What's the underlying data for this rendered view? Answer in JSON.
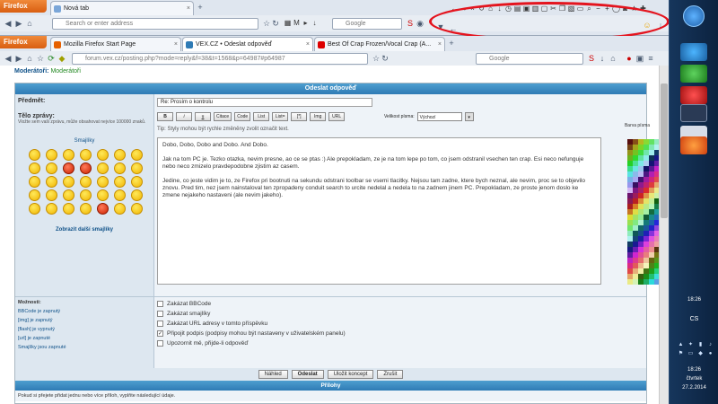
{
  "browser1": {
    "firefox_label": "Firefox",
    "tab_label": "Nová tab",
    "url_placeholder": "Search or enter address",
    "search_placeholder": "Google"
  },
  "browser2": {
    "firefox_label": "Firefox",
    "tabs": [
      {
        "label": "Mozilla Firefox Start Page"
      },
      {
        "label": "VEX.CZ • Odeslat odpověď"
      },
      {
        "label": "Best Of Crap Frozen/Vocal Crap (A..."
      }
    ],
    "url": "forum.vex.cz/posting.php?mode=reply&f=38&t=1568&p=64987#p64987",
    "search_placeholder": "Google"
  },
  "page": {
    "moderator_label": "Moderátoři:",
    "moderator_value": "Moderátoři",
    "panel_title": "Odeslat odpověď",
    "subject_label": "Předmět:",
    "subject_value": "Re: Prosím o kontrolu",
    "body_label": "Tělo zprávy:",
    "body_hint": "Vložte sem vaši zprávu, může obsahovat nejvíce 100000 znaků.",
    "smileys_title": "Smajlíky",
    "more_smileys": "Zobrazit další smajlíky",
    "bbcode_buttons": [
      "B",
      "i",
      "u",
      "Citace",
      "Code",
      "List",
      "List=",
      "[*]",
      "Img",
      "URL"
    ],
    "font_size_label": "Velikost písma:",
    "font_size_value": "Výchozí",
    "tip": "Tip: Styly mohou být rychle změněny zvolit označit text.",
    "message_lines": [
      "Dobo, Dobo, Dobo and Dobo. And Dobo.",
      "Jak na tom PC je. Tezko otazka, nevim presne, ao ce se ptas :) Ale prepokladam, ze je na tom lepe po tom, co jsem odstranil vsechen ten crap. Esi neco nefunguje nebo neco zmizelo pravdepodobne zjistim az casem.",
      "Jedine, co jeste vidim je to, ze Firefox pri bootnuti na sekundu odstrani toolbar se vsemi tlacitky. Nejsou tam zadne, ktere bych neznal, ale nevim, proc se to objevilo znovu. Pred tim, nez jsem nainstaloval ten zpropadeny conduit search to urcite nedelal a nedela to na zadnem jinem PC. Prepokladam, ze proste jenom doslo ke zmene nejakeho nastaveni (ale nevim jakeho)."
    ],
    "palette_label": "Barva písma",
    "options_label": "Možnosti:",
    "option_status": [
      "BBCode je zapnutý",
      "[img] je zapnutý",
      "[flash] je vypnutý",
      "[url] je zapnuté",
      "Smajlíky jsou zapnuté"
    ],
    "checkboxes": [
      {
        "label": "Zakázat BBCode",
        "checked": false
      },
      {
        "label": "Zakázat smajlíky",
        "checked": false
      },
      {
        "label": "Zakázat URL adresy v tomto příspěvku",
        "checked": false
      },
      {
        "label": "Připojit podpis (podpisy mohou být nastaveny v uživatelském panelu)",
        "checked": true
      },
      {
        "label": "Upozornit mě, přijde-li odpověď",
        "checked": false
      }
    ],
    "buttons": {
      "preview": "Náhled",
      "submit": "Odeslat",
      "save_draft": "Uložit koncept",
      "cancel": "Zrušit"
    },
    "attach_title": "Přílohy",
    "attach_text": "Pokud si přejete přidat jednu nebo více příloh, vyplňte následující údaje."
  },
  "taskbar": {
    "time1": "18:26",
    "day": "čtvrtek",
    "date": "27.2.2014",
    "lang": "CS",
    "time_small": "18:26"
  },
  "colors": {
    "panel_header": "#2f7bb5",
    "annotation": "#e4141e"
  }
}
